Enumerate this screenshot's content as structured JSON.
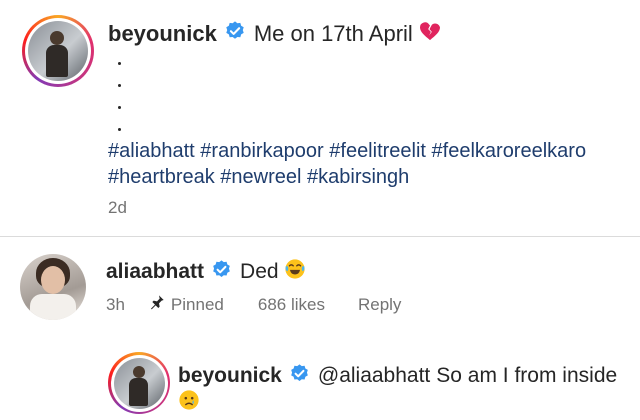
{
  "post": {
    "username": "beyounick",
    "caption": "Me on 17th April",
    "caption_emoji": "broken-heart",
    "hashtags_line1": "#aliabhatt #ranbirkapoor #feelitreelit #feelkaroreelkaro",
    "hashtags_line2": "#heartbreak #newreel #kabirsingh",
    "time": "2d"
  },
  "comment": {
    "username": "aliaabhatt",
    "text": "Ded",
    "emoji": "face-with-tears-of-joy",
    "time": "3h",
    "pinned_label": "Pinned",
    "likes": "686 likes",
    "reply_label": "Reply"
  },
  "reply": {
    "username": "beyounick",
    "mention": "@aliaabhatt",
    "text": "So am I from inside",
    "emoji": "crying-face"
  },
  "colors": {
    "verified": "#3897f0",
    "hashtag": "#1f3d6d",
    "muted": "#737373",
    "divider": "#dbdbdb"
  }
}
